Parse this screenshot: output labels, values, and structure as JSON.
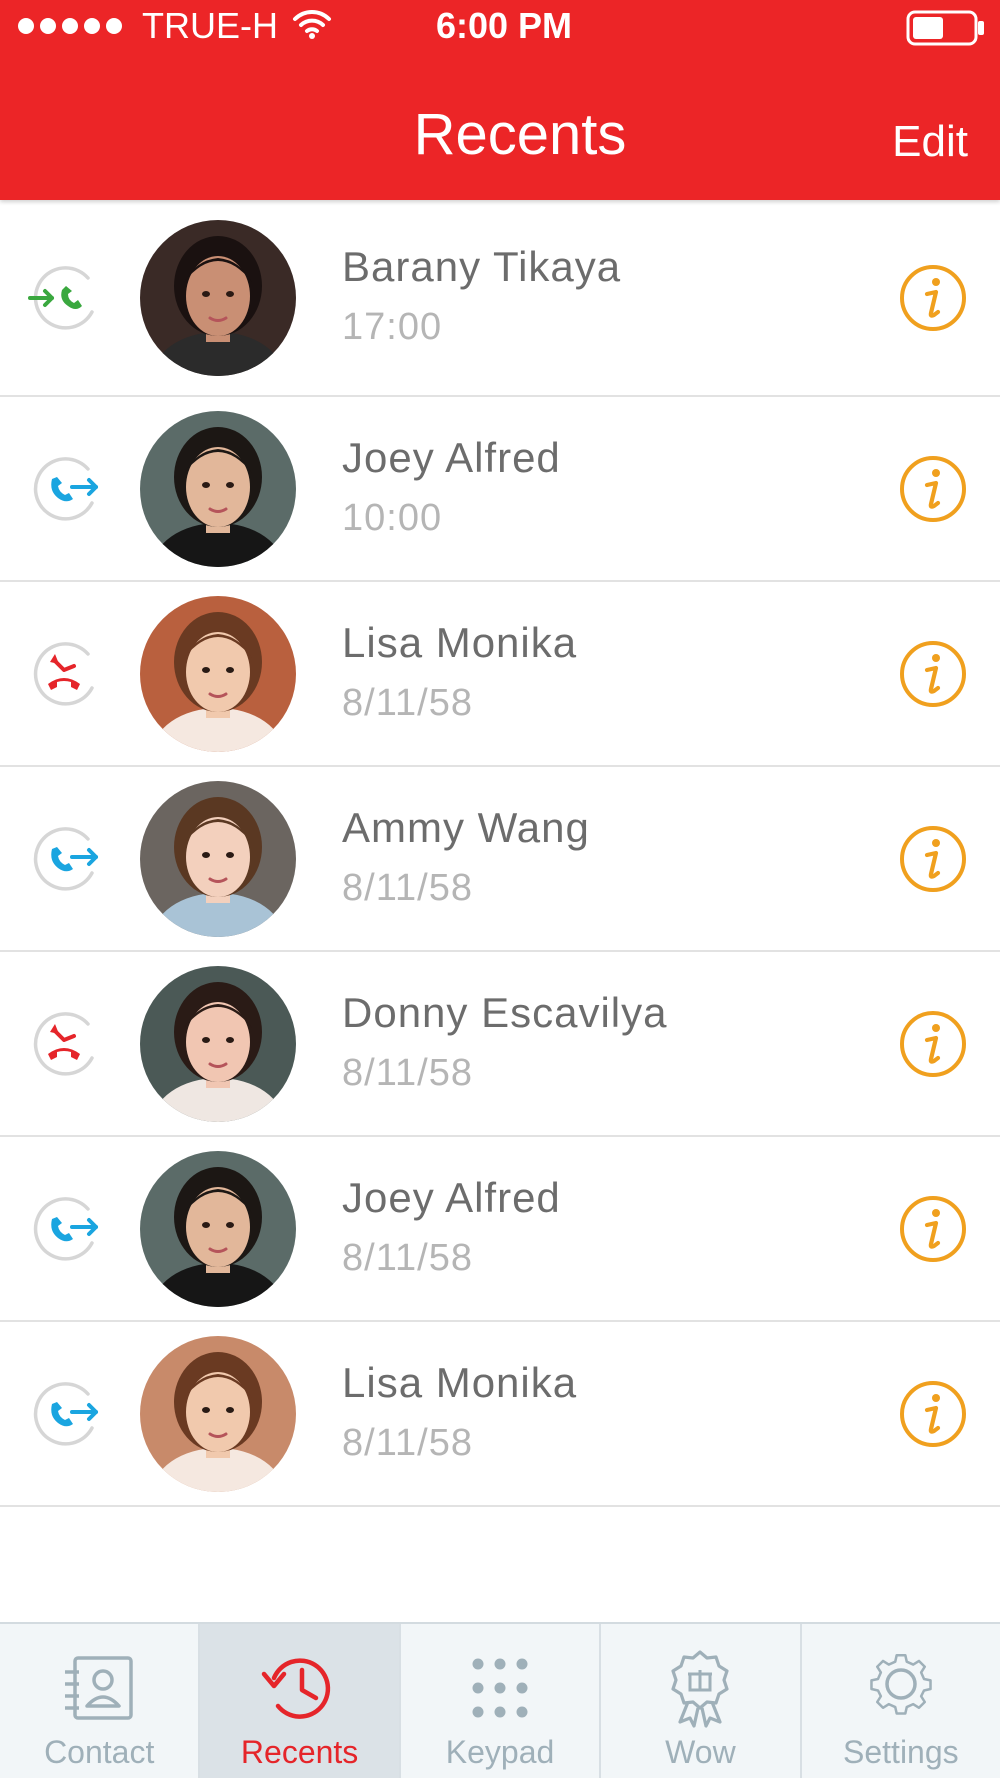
{
  "status_bar": {
    "carrier": "TRUE-H",
    "time": "6:00 PM",
    "signal_icon": "signal-dots-icon",
    "wifi_icon": "wifi-icon",
    "battery_icon": "battery-icon"
  },
  "header": {
    "title": "Recents",
    "edit_label": "Edit",
    "background_color": "#ec2527"
  },
  "calls": [
    {
      "name": "Barany Tikaya",
      "time": "17:00",
      "type": "incoming",
      "type_icon": "incoming-call-icon"
    },
    {
      "name": "Joey Alfred",
      "time": "10:00",
      "type": "outgoing",
      "type_icon": "outgoing-call-icon"
    },
    {
      "name": "Lisa Monika",
      "time": "8/11/58",
      "type": "missed",
      "type_icon": "missed-call-icon"
    },
    {
      "name": "Ammy Wang",
      "time": "8/11/58",
      "type": "outgoing",
      "type_icon": "outgoing-call-icon"
    },
    {
      "name": "Donny Escavilya",
      "time": "8/11/58",
      "type": "missed",
      "type_icon": "missed-call-icon"
    },
    {
      "name": "Joey Alfred",
      "time": "8/11/58",
      "type": "outgoing",
      "type_icon": "outgoing-call-icon"
    },
    {
      "name": "Lisa Monika",
      "time": "8/11/58",
      "type": "outgoing",
      "type_icon": "outgoing-call-icon"
    }
  ],
  "colors": {
    "incoming": "#3aa83f",
    "outgoing": "#1aa5e0",
    "missed": "#e5252a",
    "info": "#f0a01e",
    "tab_active": "#e5252a",
    "tab_inactive": "#9fb0b9"
  },
  "tabs": [
    {
      "label": "Contact",
      "icon": "contact-card-icon",
      "active": false
    },
    {
      "label": "Recents",
      "icon": "clock-history-icon",
      "active": true
    },
    {
      "label": "Keypad",
      "icon": "keypad-icon",
      "active": false
    },
    {
      "label": "Wow",
      "icon": "gift-badge-icon",
      "active": false
    },
    {
      "label": "Settings",
      "icon": "gear-icon",
      "active": false
    }
  ]
}
